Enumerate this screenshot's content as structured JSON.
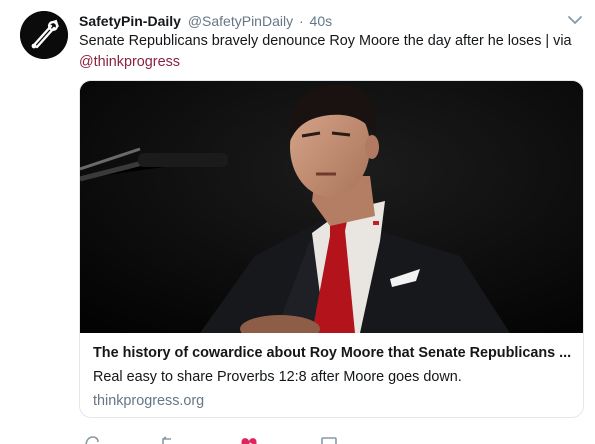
{
  "tweet": {
    "display_name": "SafetyPin-Daily",
    "handle": "@SafetyPinDaily",
    "separator": "·",
    "time": "40s",
    "text": "Senate Republicans bravely denounce Roy Moore the day after he loses | via",
    "mention": "@thinkprogress"
  },
  "card": {
    "title": "The history of cowardice about Roy Moore that Senate Republicans ...",
    "description": "Real easy to share Proverbs 12:8 after Moore goes down.",
    "domain": "thinkprogress.org"
  },
  "icons": {
    "avatar": "safety-pin-logo",
    "caret": "chevron-down-icon",
    "actions": [
      "reply-icon",
      "retweet-icon",
      "like-icon",
      "direct-message-icon"
    ]
  },
  "colors": {
    "link": "#8b2340",
    "muted": "#657786",
    "like": "#e0245e"
  }
}
